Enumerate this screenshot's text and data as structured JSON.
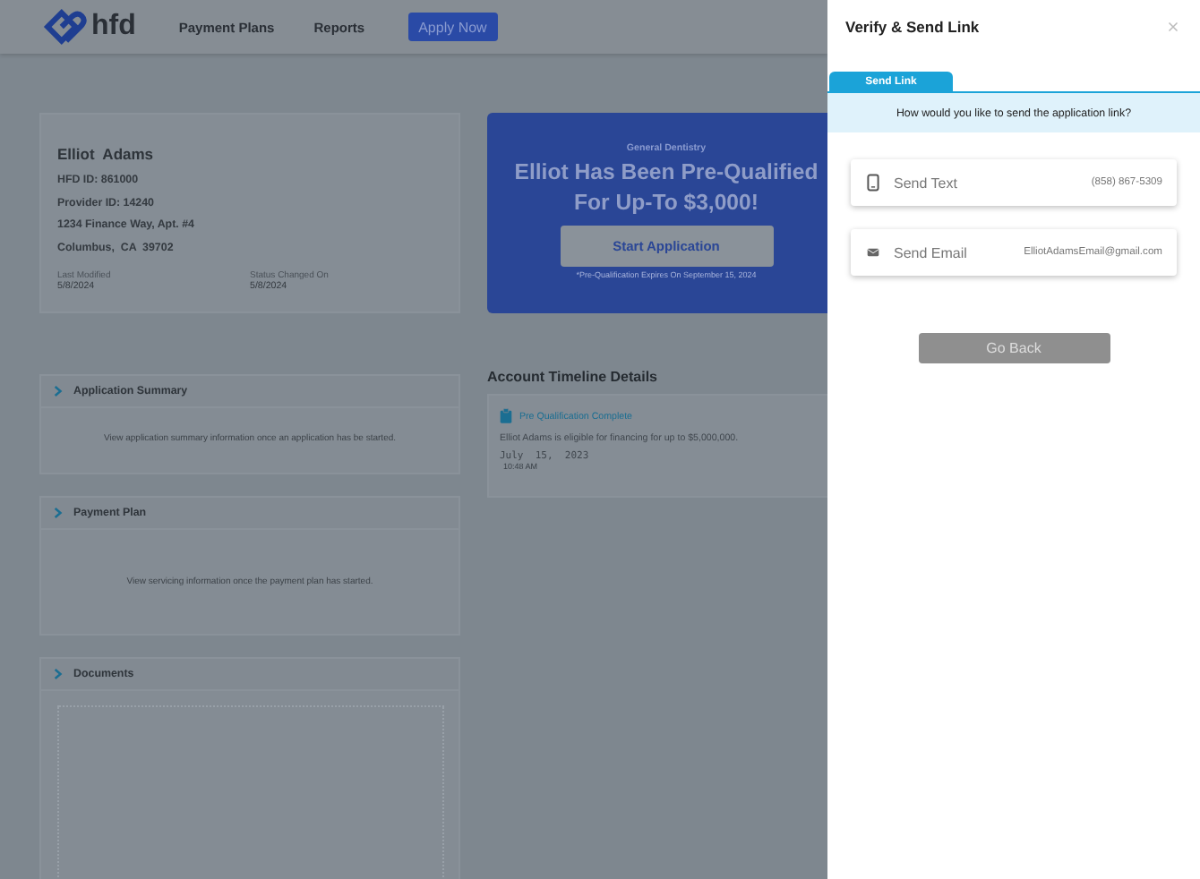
{
  "header": {
    "logo_text": "hfd",
    "nav": [
      "Payment Plans",
      "Reports"
    ],
    "apply_button": "Apply Now"
  },
  "customer": {
    "name": "Elliot  Adams",
    "lines": [
      "HFD ID: 861000",
      "Provider ID: 14240",
      "1234 Finance Way, Apt. #4",
      "Columbus,  CA  39702"
    ],
    "dates": [
      {
        "label": "Last Modified",
        "value": "5/8/2024"
      },
      {
        "label": "Status Changed On",
        "value": "5/8/2024"
      }
    ]
  },
  "promo": {
    "category": "General Dentistry",
    "headline": [
      "Elliot Has Been Pre-Qualified",
      "For Up-To $3,000!"
    ],
    "button": "Start Application",
    "note": "*Pre-Qualification Expires On September 15, 2024"
  },
  "sections": [
    {
      "kind": "message",
      "title": "Application Summary",
      "expanded": false,
      "message": "View application summary information once an application has be started."
    },
    {
      "kind": "message",
      "title": "Payment Plan",
      "expanded": false,
      "message": "View servicing information once the payment plan has started."
    },
    {
      "kind": "upload",
      "title": "Documents",
      "expanded": false
    }
  ],
  "timeline": {
    "title": "Account Timeline Details",
    "events": [
      {
        "title": "Pre Qualification Complete",
        "description": "Elliot Adams is eligible for financing for up to $5,000,000.",
        "date": "July  15,  2023",
        "time": "10:48 AM"
      }
    ]
  },
  "drawer": {
    "title": "Verify & Send Link",
    "tabs": [
      {
        "label": "Send Link",
        "selected": true
      }
    ],
    "prompt": "How would you like to send the application link?",
    "options": [
      {
        "kind": "text",
        "label": "Send Text",
        "value": "(858) 867-5309"
      },
      {
        "kind": "email",
        "label": "Send Email",
        "value": "ElliotAdamsEmail@gmail.com"
      }
    ],
    "back_button": "Go Back"
  }
}
